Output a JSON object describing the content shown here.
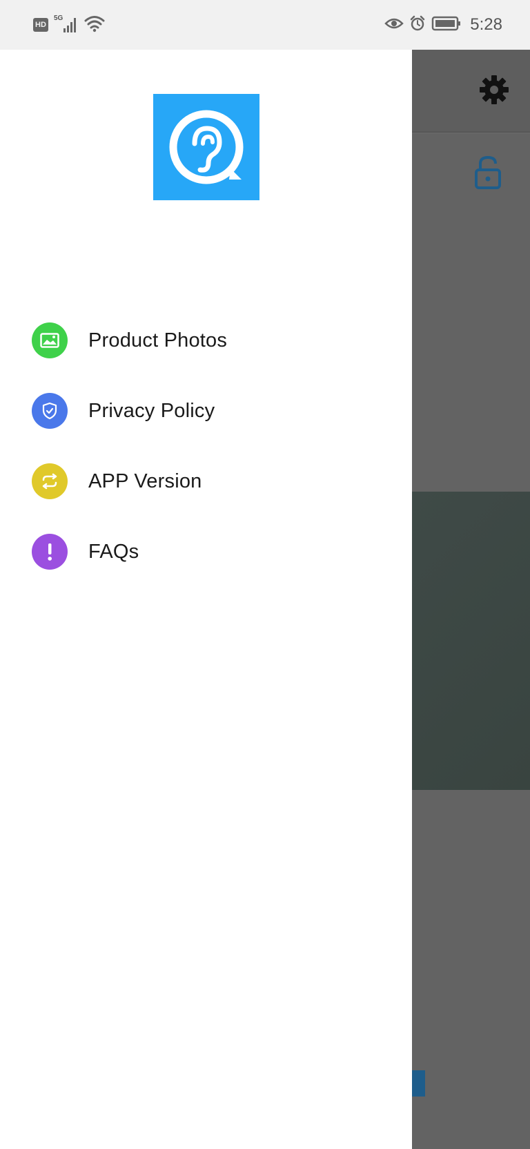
{
  "status_bar": {
    "hd_badge": "HD",
    "network_type": "5G",
    "time": "5:28",
    "icons": [
      "hd-icon",
      "signal-icon",
      "wifi-icon",
      "eye-icon",
      "alarm-icon",
      "battery-icon"
    ]
  },
  "drawer": {
    "logo_icon": "ear-chat-logo-icon",
    "menu": [
      {
        "label": "Product Photos",
        "icon": "image-icon",
        "color": "#3fd14a"
      },
      {
        "label": "Privacy Policy",
        "icon": "shield-check-icon",
        "color": "#4a78ea"
      },
      {
        "label": "APP Version",
        "icon": "refresh-icon",
        "color": "#e0c92a"
      },
      {
        "label": "FAQs",
        "icon": "exclamation-icon",
        "color": "#9b4fe0"
      }
    ]
  },
  "background_app": {
    "toolbar_icon": "gear-icon",
    "lock_icon": "unlock-icon",
    "accent_color": "#1e5d8b"
  }
}
